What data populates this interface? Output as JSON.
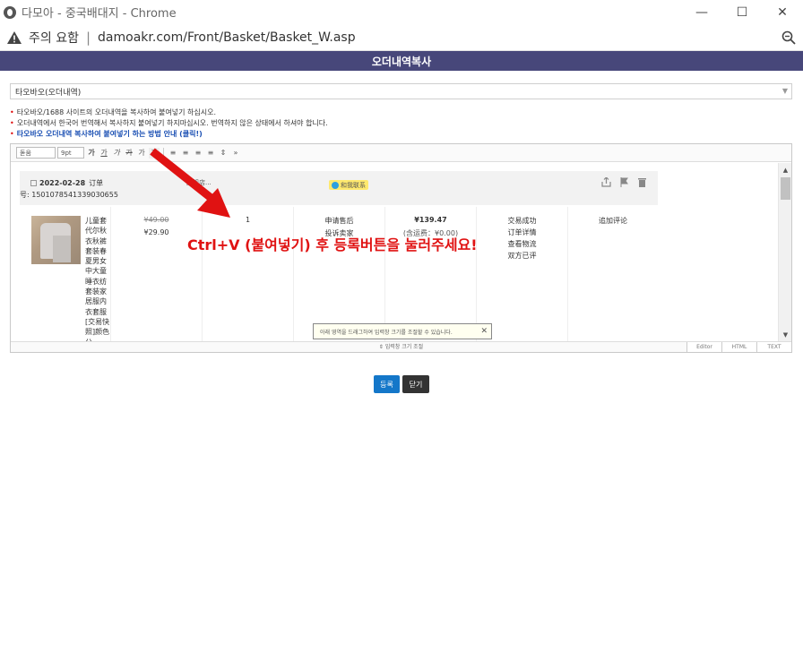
{
  "window": {
    "title": "다모아 - 중국배대지 - Chrome",
    "controls": {
      "minimize": "—",
      "maximize": "☐",
      "close": "✕"
    }
  },
  "address_bar": {
    "security_label": "주의 요함",
    "separator": "|",
    "url": "damoakr.com/Front/Basket/Basket_W.asp"
  },
  "header": {
    "title": "오더내역복사"
  },
  "source_select": {
    "value": "타오바오(오더내역)"
  },
  "notes": {
    "line1": "타오바오/1688 사이트의 오더내역을 복사하여 붙여넣기 하십시오.",
    "line2": "오더내역에서 한국어 번역해서 복사하지 붙여넣기 하지마십시오. 번역하지 않은 상태에서 하셔야 합니다.",
    "line3": "타오바오 오더내역 복사하여 붙여넣기 하는 방법 안내 (클릭!)",
    "bullet": "•"
  },
  "toolbar": {
    "font": "돋움",
    "size": "9pt",
    "bold": "가",
    "underline": "가",
    "italic": "가",
    "strike": "가",
    "color": "가",
    "bg": "가",
    "more": "»"
  },
  "order": {
    "date": "2022-02-28",
    "date_label": "订单",
    "order_no": "号: 1501078541339030655",
    "shop": "旗舰店...",
    "badge": "和我联系",
    "item": {
      "name": "儿童套代尔秋衣秋裤套装春夏男女中大童睡衣纺套装家居服内衣套服 [交易快照]颜色分",
      "price_old": "¥49.00",
      "price_new": "¥29.90",
      "qty": "1",
      "service1": "申请售后",
      "service2": "投诉卖家",
      "total": "¥139.47",
      "shipping": "(含运费：¥0.00)",
      "status": [
        "交易成功",
        "订单详情",
        "查看物流",
        "双方已评"
      ],
      "review": "追加评论"
    }
  },
  "tooltip": {
    "text": "아래 영역을 드래그하여 입력창 크기를 조절할 수 있습니다.",
    "close": "✕"
  },
  "resize_hint": "⇕ 입력창 크기 조절",
  "modes": [
    "Editor",
    "HTML",
    "TEXT"
  ],
  "buttons": {
    "register": "등록",
    "close": "닫기"
  },
  "overlay": {
    "text": "Ctrl+V (붙여넣기) 후 등록버튼을 눌러주세요!"
  },
  "colors": {
    "header_bg": "#47477a",
    "register_bg": "#1477c9",
    "close_bg": "#333333",
    "overlay_red": "#e01212"
  }
}
